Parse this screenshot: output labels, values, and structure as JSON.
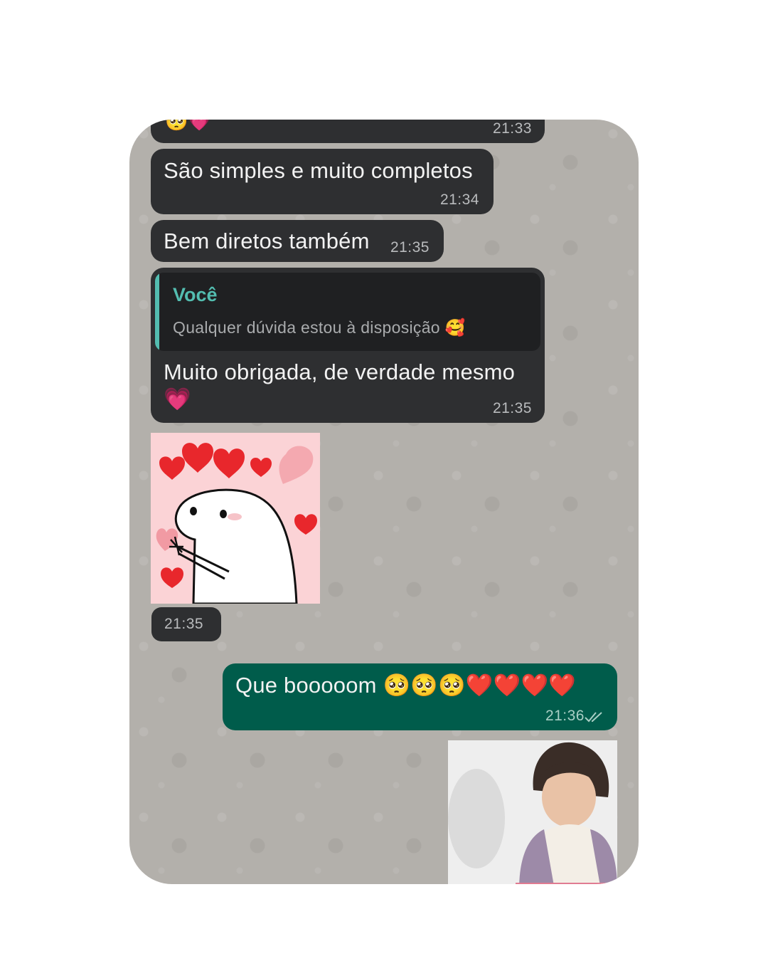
{
  "messages": [
    {
      "id": "b0",
      "emojis": "🥺💗",
      "time": "21:33"
    },
    {
      "id": "b1",
      "text": "São simples e muito completos",
      "time": "21:34"
    },
    {
      "id": "b2",
      "text": "Bem diretos também",
      "time": "21:35"
    },
    {
      "id": "b3",
      "quote_author": "Você",
      "quote_text": "Qualquer dúvida estou à disposição 🥰",
      "text": "Muito obrigada, de verdade mesmo 💗",
      "time": "21:35"
    },
    {
      "id": "sticker",
      "time": "21:35"
    },
    {
      "id": "b4",
      "text": "Que booooom 🥺🥺🥺❤️❤️❤️❤️",
      "time": "21:36",
      "status": "read"
    }
  ],
  "colors": {
    "incoming_bubble": "#2e2f31",
    "outgoing_bubble": "#005c4b",
    "quote_accent": "#53bdb0",
    "chat_background": "#b3b0ab"
  },
  "icons": [
    "double-check-icon"
  ]
}
